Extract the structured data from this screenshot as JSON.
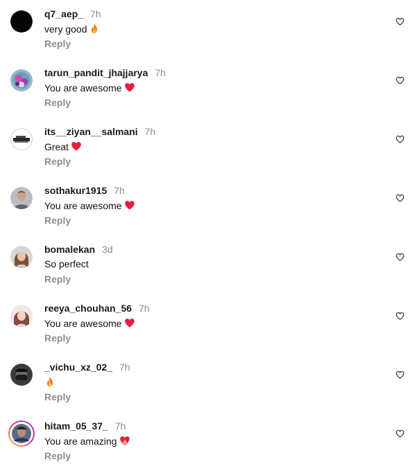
{
  "reply_label": "Reply",
  "comments": [
    {
      "username": "q7_aep_",
      "time": "7h",
      "text": "very good",
      "emoji": "fire-emoji-icon"
    },
    {
      "username": "tarun_pandit_jhajjarya",
      "time": "7h",
      "text": "You are awesome",
      "emoji": "red-heart-emoji-icon"
    },
    {
      "username": "its__ziyan__salmani",
      "time": "7h",
      "text": "Great",
      "emoji": "red-heart-emoji-icon"
    },
    {
      "username": "sothakur1915",
      "time": "7h",
      "text": "You are awesome",
      "emoji": "red-heart-emoji-icon"
    },
    {
      "username": "bomalekan",
      "time": "3d",
      "text": "So perfect",
      "emoji": ""
    },
    {
      "username": "reeya_chouhan_56",
      "time": "7h",
      "text": "You are awesome",
      "emoji": "red-heart-emoji-icon"
    },
    {
      "username": "_vichu_xz_02_",
      "time": "7h",
      "text": "",
      "emoji": "fire-emoji-icon"
    },
    {
      "username": "hitam_05_37_",
      "time": "7h",
      "text": "You are amazing",
      "emoji": "heart-on-fire-emoji-icon"
    }
  ],
  "colors": {
    "username": "#1a1a1a",
    "timestamp": "#8a8a8a",
    "reply": "#8e8e8e",
    "heart_emoji": "#e8203a",
    "fire_emoji": "#f5761a"
  }
}
